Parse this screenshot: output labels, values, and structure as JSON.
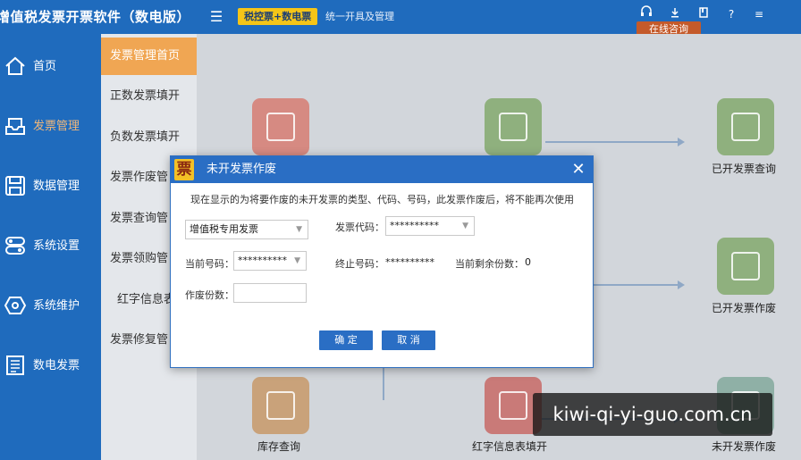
{
  "app": {
    "title": "增值税发票开票软件（数电版）",
    "mode_badge": "税控票+数电票",
    "mode_desc": "统一开具及管理",
    "consult_label": "在线咨询"
  },
  "sidebar": {
    "items": [
      {
        "label": "首页",
        "icon": "home-icon"
      },
      {
        "label": "发票管理",
        "icon": "invoice-tray-icon"
      },
      {
        "label": "数据管理",
        "icon": "save-icon"
      },
      {
        "label": "系统设置",
        "icon": "toggle-icon"
      },
      {
        "label": "系统维护",
        "icon": "hexagon-icon"
      },
      {
        "label": "数电发票",
        "icon": "document-icon"
      }
    ],
    "active_index": 1
  },
  "submenu": {
    "items": [
      {
        "label": "发票管理首页"
      },
      {
        "label": "正数发票填开"
      },
      {
        "label": "负数发票填开"
      },
      {
        "label": "发票作废管"
      },
      {
        "label": "发票查询管"
      },
      {
        "label": "发票领购管"
      },
      {
        "label": "红字信息表"
      },
      {
        "label": "发票修复管"
      }
    ],
    "active_index": 0
  },
  "main": {
    "tiles": [
      {
        "label": "已开发票查询"
      },
      {
        "label": "已开发票作废"
      },
      {
        "label": "库存查询"
      },
      {
        "label": "红字信息表填开"
      },
      {
        "label": "未开发票作废"
      }
    ]
  },
  "dialog": {
    "title": "未开发票作废",
    "logo_char": "票",
    "notice": "现在显示的为将要作废的未开发票的类型、代码、号码，此发票作废后，将不能再次使用",
    "invoice_type": "增值税专用发票",
    "invoice_code_label": "发票代码：",
    "invoice_code_value": "**********",
    "current_no_label": "当前号码：",
    "current_no_value": "**********",
    "end_no_label": "终止号码：",
    "end_no_value": "**********",
    "remaining_label": "当前剩余份数：",
    "remaining_value": "0",
    "void_count_label": "作废份数：",
    "void_count_value": "",
    "confirm_label": "确 定",
    "cancel_label": "取 消"
  },
  "watermark": "kiwi-qi-yi-guo.com.cn",
  "colors": {
    "brand_blue": "#1f6bbd",
    "accent_orange": "#f0a653",
    "badge_yellow": "#f5c518"
  }
}
